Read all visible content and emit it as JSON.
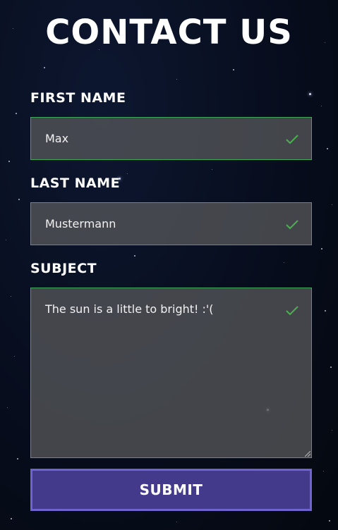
{
  "page": {
    "title": "CONTACT US"
  },
  "form": {
    "first_name": {
      "label": "FIRST NAME",
      "value": "Max",
      "valid": true
    },
    "last_name": {
      "label": "LAST NAME",
      "value": "Mustermann",
      "valid": true
    },
    "subject": {
      "label": "SUBJECT",
      "value": "The sun is a little to bright! :'(",
      "valid": true
    },
    "submit_label": "SUBMIT"
  },
  "icons": {
    "valid_indicator": "check-icon",
    "textarea_resize": "resize-grip-icon"
  },
  "colors": {
    "valid_border": "#3fa95a",
    "check_mark": "#4caf50",
    "submit_bg": "#443a8c",
    "submit_border": "#6f63cf",
    "field_bg": "#555658"
  }
}
